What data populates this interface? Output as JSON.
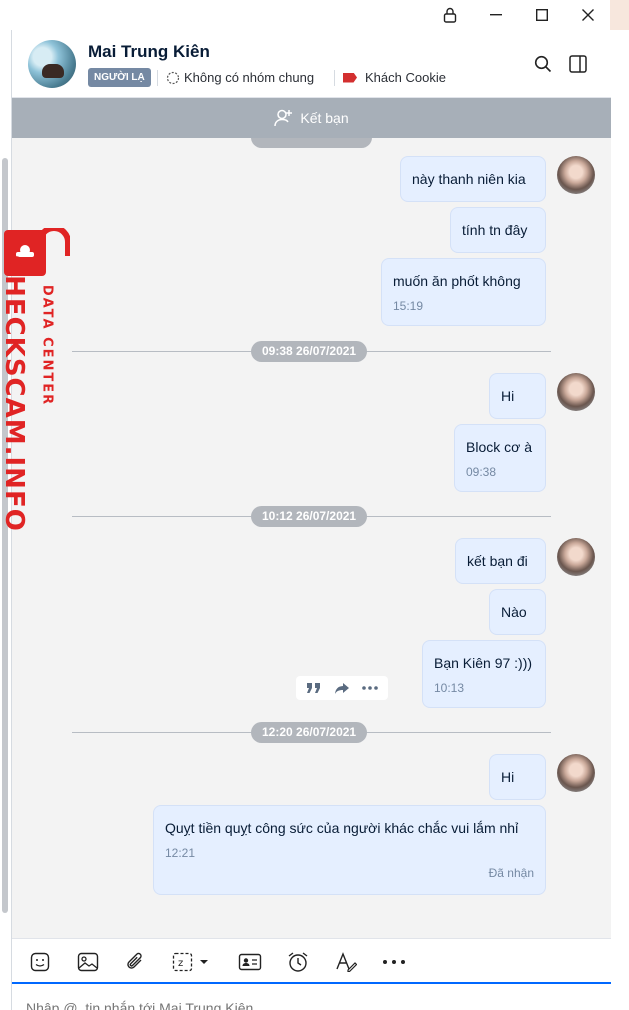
{
  "header": {
    "name": "Mai Trung Kiên",
    "badge": "NGƯỜI LẠ",
    "groups": "Không có nhóm chung",
    "tag": "Khách Cookie",
    "tag_color": "#d32f2f"
  },
  "add_friend": {
    "label": "Kết bạn"
  },
  "watermark": {
    "line1": "CHECKSCAM.INFO",
    "line2": "DATA CENTER",
    "color": "#e02424"
  },
  "messages": [
    {
      "text": "này thanh niên kia"
    },
    {
      "text": "tính tn đây"
    },
    {
      "text": "muốn ăn phốt không",
      "time": "15:19"
    },
    {
      "divider": "09:38 26/07/2021"
    },
    {
      "text": "Hi"
    },
    {
      "text": "Block cơ à",
      "time": "09:38"
    },
    {
      "divider": "10:12 26/07/2021"
    },
    {
      "text": "kết bạn đi"
    },
    {
      "text": "Nào"
    },
    {
      "text": "Bạn Kiên 97 :)))",
      "time": "10:13"
    },
    {
      "divider": "12:20 26/07/2021"
    },
    {
      "text": "Hi"
    },
    {
      "text": "Quỵt tiền quỵt công sức của người khác chắc vui lắm nhỉ",
      "time": "12:21",
      "status": "Đã nhận"
    }
  ],
  "composer": {
    "placeholder": "Nhập @, tin nhắn tới Mai Trung Kiên"
  },
  "colors": {
    "bubble": "#e5efff",
    "accent": "#0068ff",
    "add_friend_bar": "#a7afb8"
  }
}
